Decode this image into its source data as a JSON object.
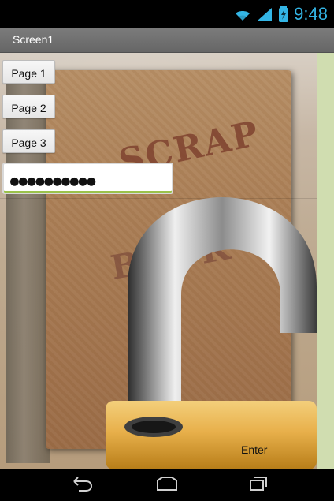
{
  "status_bar": {
    "time": "9:48",
    "icons": [
      "wifi-icon",
      "signal-icon",
      "battery-icon"
    ],
    "accent": "#33b5e5"
  },
  "app": {
    "title": "Screen1"
  },
  "buttons": {
    "page1": "Page 1",
    "page2": "Page 2",
    "page3": "Page 3",
    "enter": "Enter"
  },
  "password": {
    "value": "●●●●●●●●●●"
  },
  "background": {
    "image": "scrapbook-cover",
    "overlay": "padlock"
  },
  "navigation": {
    "icons": [
      "back-icon",
      "home-icon",
      "recent-apps-icon"
    ]
  }
}
